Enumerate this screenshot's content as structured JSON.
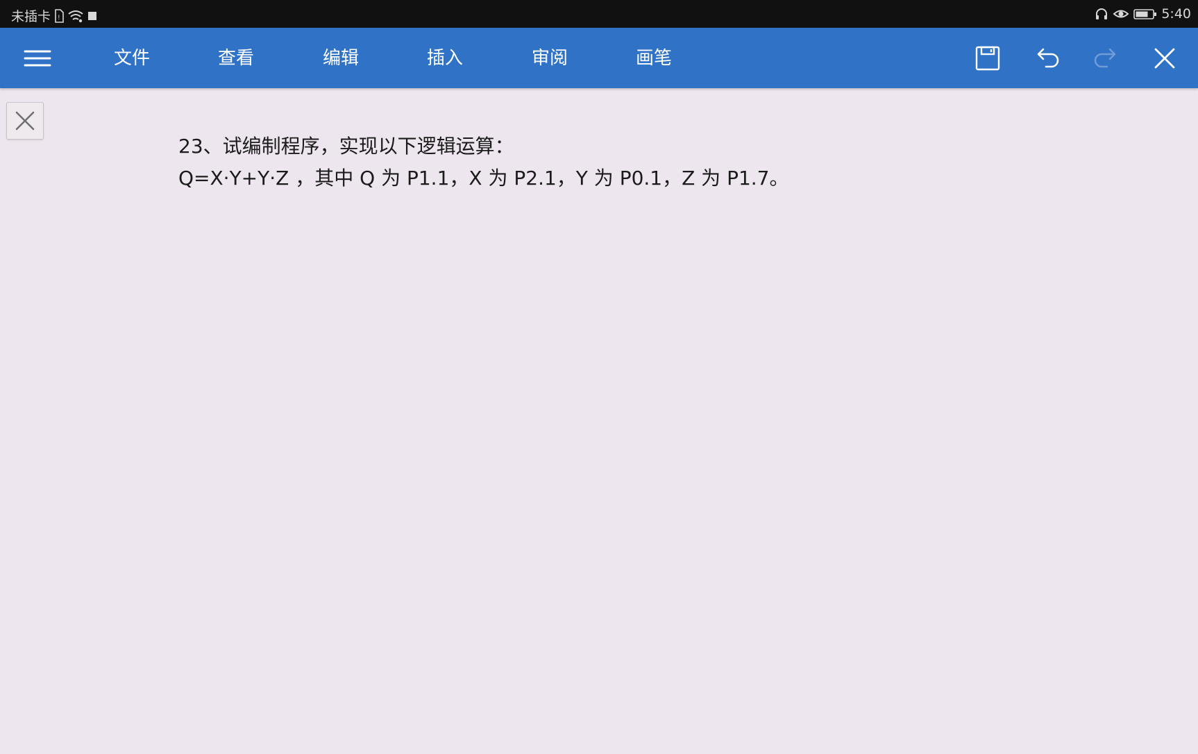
{
  "status_bar": {
    "carrier": "未插卡",
    "time": "5:40",
    "icons": [
      "sim-icon",
      "wifi-icon",
      "square-icon",
      "headphones-icon",
      "eye-icon",
      "battery-icon"
    ]
  },
  "toolbar": {
    "tabs": [
      {
        "label": "文件"
      },
      {
        "label": "查看"
      },
      {
        "label": "编辑"
      },
      {
        "label": "插入"
      },
      {
        "label": "审阅"
      },
      {
        "label": "画笔"
      }
    ],
    "icons": [
      "menu-icon",
      "save-icon",
      "undo-icon",
      "redo-icon",
      "close-icon"
    ],
    "redo_enabled": false
  },
  "document": {
    "lines": [
      "23、试编制程序，实现以下逻辑运算：",
      "Q=X·Y+Y·Z  ，其中 Q 为 P1.1，X 为 P2.1，Y 为 P0.1，Z 为  P1.7。"
    ]
  },
  "colors": {
    "toolbar": "#2f72c6",
    "status_bar": "#111111",
    "page_background": "#ede6ee",
    "text": "#1b1b1b"
  }
}
